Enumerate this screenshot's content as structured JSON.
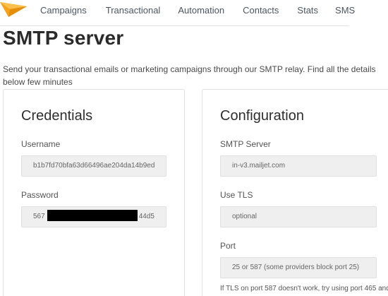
{
  "nav": {
    "items": [
      "Campaigns",
      "Transactional",
      "Automation",
      "Contacts",
      "Stats",
      "SMS"
    ]
  },
  "page": {
    "title": "SMTP server",
    "intro": "Send your transactional emails or marketing campaigns through our SMTP relay. Find all the details below few minutes"
  },
  "credentials": {
    "title": "Credentials",
    "username_label": "Username",
    "username_value": "b1b7fd70bfa63d66496ae204da14b9ed",
    "password_label": "Password",
    "password_prefix": "567",
    "password_suffix": "44d5"
  },
  "configuration": {
    "title": "Configuration",
    "server_label": "SMTP Server",
    "server_value": "in-v3.mailjet.com",
    "tls_label": "Use TLS",
    "tls_value": "optional",
    "port_label": "Port",
    "port_value": "25 or 587 (some providers block port 25)",
    "note": "If TLS on port 587 doesn't work, try using port 465 and"
  },
  "colors": {
    "logo": "#f7a21b",
    "nav_text": "#4b5563",
    "field_bg": "#efefef"
  },
  "icons": {
    "logo": "mailjet-paper-plane-icon"
  }
}
